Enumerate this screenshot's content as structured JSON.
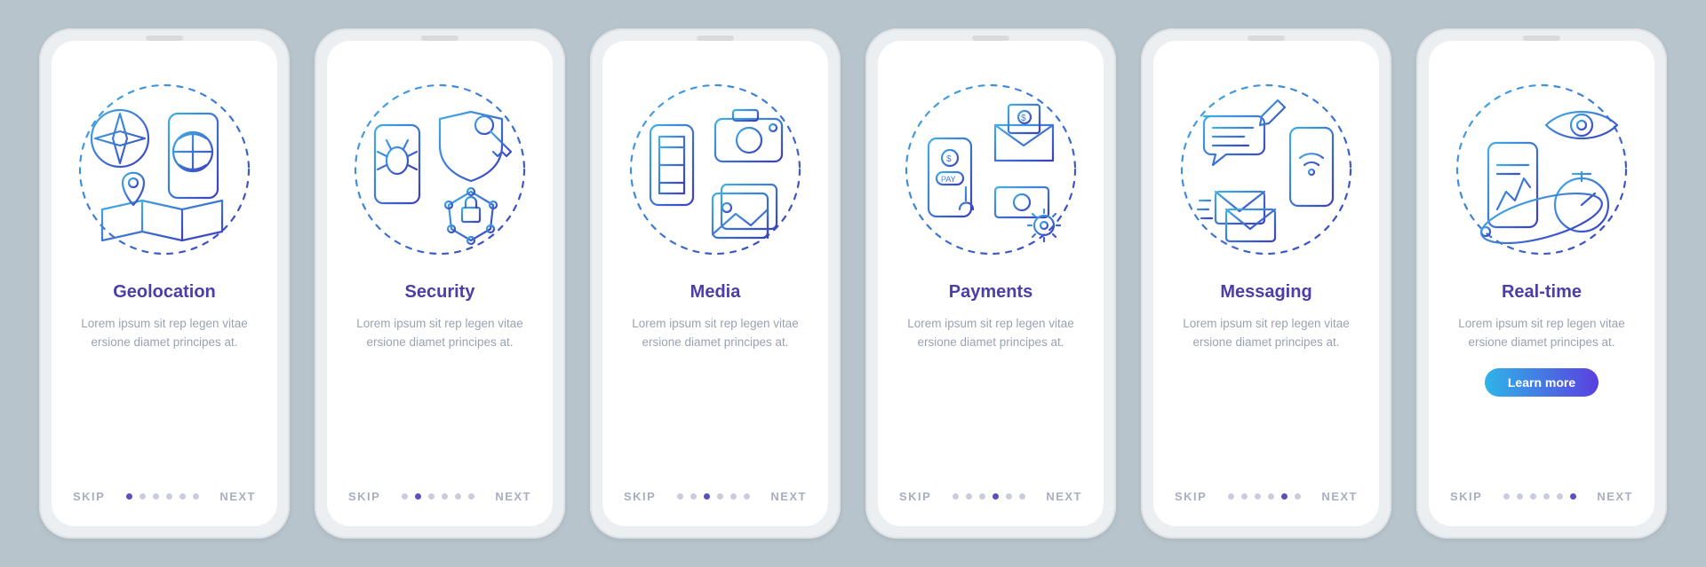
{
  "nav": {
    "skip": "SKIP",
    "next": "NEXT"
  },
  "cta_label": "Learn more",
  "total_dots": 6,
  "description": "Lorem ipsum sit rep legen vitae ersione diamet principes at.",
  "cards": [
    {
      "title": "Geolocation",
      "icon_name": "geolocation-icon",
      "active_dot": 0,
      "has_cta": false
    },
    {
      "title": "Security",
      "icon_name": "security-icon",
      "active_dot": 1,
      "has_cta": false
    },
    {
      "title": "Media",
      "icon_name": "media-icon",
      "active_dot": 2,
      "has_cta": false
    },
    {
      "title": "Payments",
      "icon_name": "payments-icon",
      "active_dot": 3,
      "has_cta": false
    },
    {
      "title": "Messaging",
      "icon_name": "messaging-icon",
      "active_dot": 4,
      "has_cta": false
    },
    {
      "title": "Real-time",
      "icon_name": "realtime-icon",
      "active_dot": 5,
      "has_cta": true
    }
  ]
}
